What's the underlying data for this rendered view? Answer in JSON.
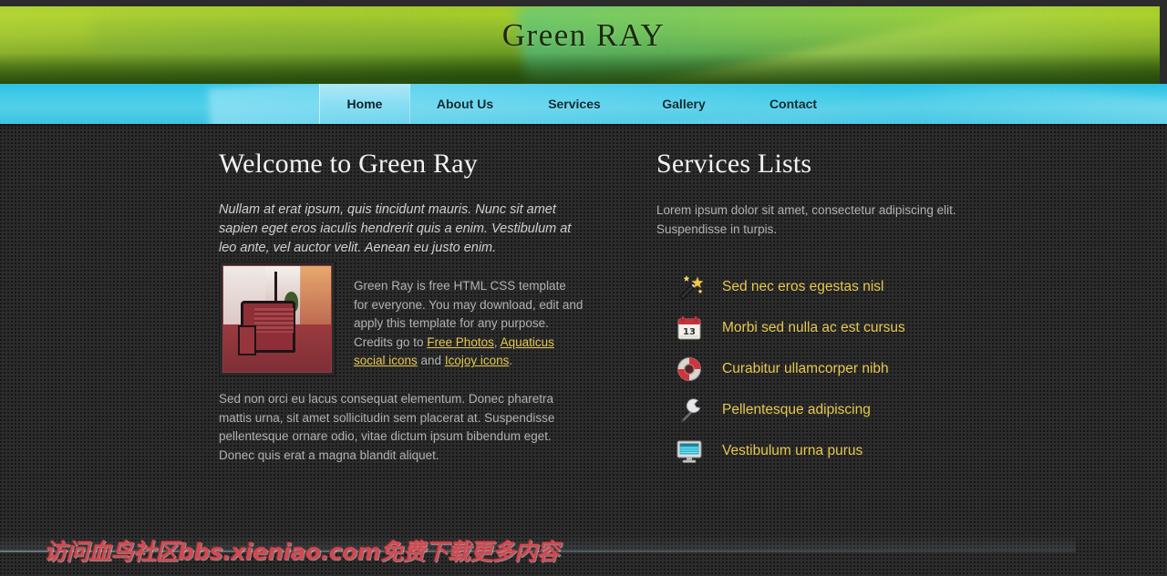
{
  "site": {
    "title": "Green RAY"
  },
  "nav": {
    "items": [
      {
        "label": "Home",
        "active": true,
        "name": "nav-item-home"
      },
      {
        "label": "About Us",
        "active": false,
        "name": "nav-item-about-us"
      },
      {
        "label": "Services",
        "active": false,
        "name": "nav-item-services"
      },
      {
        "label": "Gallery",
        "active": false,
        "name": "nav-item-gallery"
      },
      {
        "label": "Contact",
        "active": false,
        "name": "nav-item-contact"
      }
    ]
  },
  "main": {
    "heading": "Welcome to Green Ray",
    "lead": "Nullam at erat ipsum, quis tincidunt mauris. Nunc sit amet sapien eget eros iaculis hendrerit quis a enim. Vestibulum at leo ante, vel auctor velit. Aenean eu justo enim.",
    "intro_part1": "Green Ray is free HTML CSS template for everyone. You may download, edit and apply this template for any purpose. Credits go to ",
    "link_free_photos": "Free Photos",
    "intro_comma": ", ",
    "link_aquaticus": "Aquaticus social icons",
    "intro_and": " and ",
    "link_icojoy": "Icojoy icons",
    "intro_period": ".",
    "paragraph2": "Sed non orci eu lacus consequat elementum. Donec pharetra mattis urna, sit amet sollicitudin sem placerat at. Suspendisse pellentesque ornare odio, vitae dictum ipsum bibendum eget. Donec quis erat a magna blandit aliquet.",
    "thumbnail_alt": "interior-with-red-armchair"
  },
  "sidebar": {
    "heading": "Services Lists",
    "lead": "Lorem ipsum dolor sit amet, consectetur adipiscing elit. Suspendisse in turpis.",
    "items": [
      {
        "label": "Sed nec eros egestas nisl",
        "icon": "magic-wand-icon"
      },
      {
        "label": "Morbi sed nulla ac est cursus",
        "icon": "calendar-icon"
      },
      {
        "label": "Curabitur ullamcorper nibh",
        "icon": "lifebuoy-icon"
      },
      {
        "label": "Pellentesque adipiscing",
        "icon": "wrench-icon"
      },
      {
        "label": "Vestibulum urna purus",
        "icon": "monitor-icon"
      }
    ]
  },
  "footer": {
    "watermark": "访问血鸟社区bbs.xieniao.com免费下载更多内容"
  },
  "colors": {
    "header_green_light": "#a8ce2a",
    "header_green_dark": "#274d0b",
    "nav_cyan": "#41cbe8",
    "page_background": "#2c2c2c",
    "link_gold": "#e6c84e",
    "body_text": "#b2b2b2",
    "heading_white": "#f2f2f2",
    "watermark_red": "#cf4a52"
  }
}
